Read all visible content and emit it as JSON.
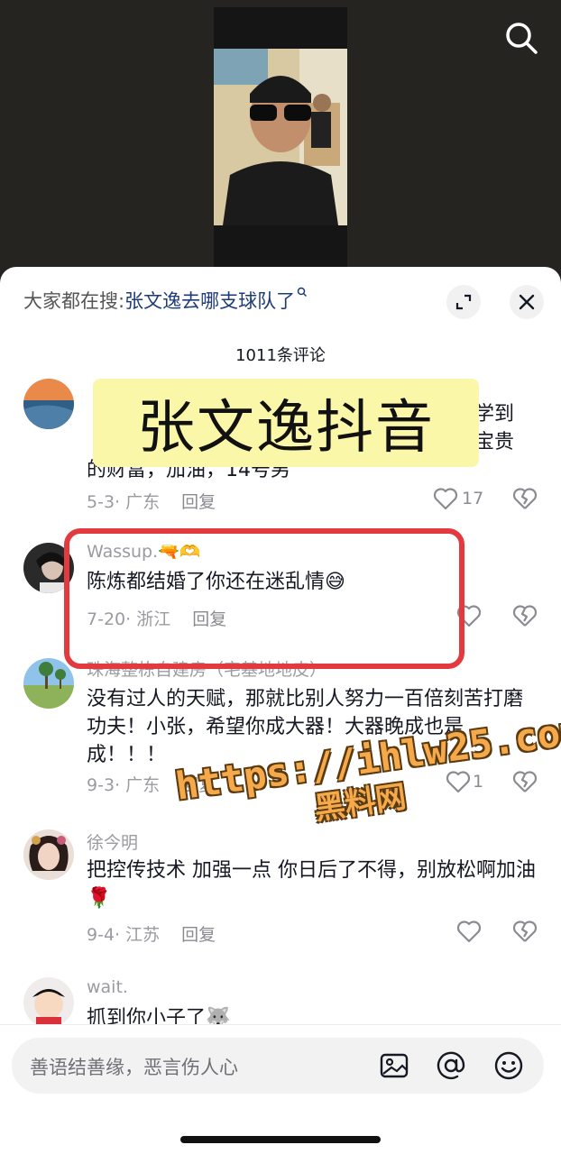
{
  "trending": {
    "prefix": "大家都在搜:",
    "keyword": "张文逸去哪支球队了",
    "icon": "search-small-icon"
  },
  "comment_count": "1011条评论",
  "comments": [
    {
      "text": "学到宝贵的财富，加油，14号男",
      "text_visible_lines": [
        "学到",
        "宝贵",
        "的财富，加油，14号男"
      ],
      "date": "5-3",
      "location": "广东",
      "reply": "回复",
      "likes": "17"
    },
    {
      "user": "Wassup.",
      "user_emoji": "🔫🫶",
      "text": "陈炼都结婚了你还在迷乱情😅",
      "date": "7-20",
      "location": "浙江",
      "reply": "回复",
      "likes": ""
    },
    {
      "user": "珠海整栋自建房（宅基地地皮）",
      "text": "没有过人的天赋，那就比别人努力一百倍刻苦打磨功夫！小张，希望你成大器！大器晚成也是成！！！",
      "date": "9-3",
      "location": "广东",
      "reply": "回复",
      "likes": "1"
    },
    {
      "user": "徐今明",
      "text": "把控传技术 加强一点 你日后了不得，别放松啊加油🌹",
      "date": "9-4",
      "location": "江苏",
      "reply": "回复",
      "likes": ""
    },
    {
      "user": "wait.",
      "text": "抓到你小子了🐺"
    }
  ],
  "overlay": {
    "banner": "张文逸抖音",
    "watermark_url": "https://ihlw25.com",
    "watermark_name": "黑料网"
  },
  "input": {
    "placeholder": "善语结善缘，恶言伤人心",
    "icons": [
      "image-icon",
      "at-icon",
      "emoji-icon"
    ]
  },
  "colors": {
    "highlight_border": "#e23a3f",
    "banner_bg": "#fbf7a9",
    "watermark": "#f5a94a",
    "keyword": "#1d3b7a"
  }
}
